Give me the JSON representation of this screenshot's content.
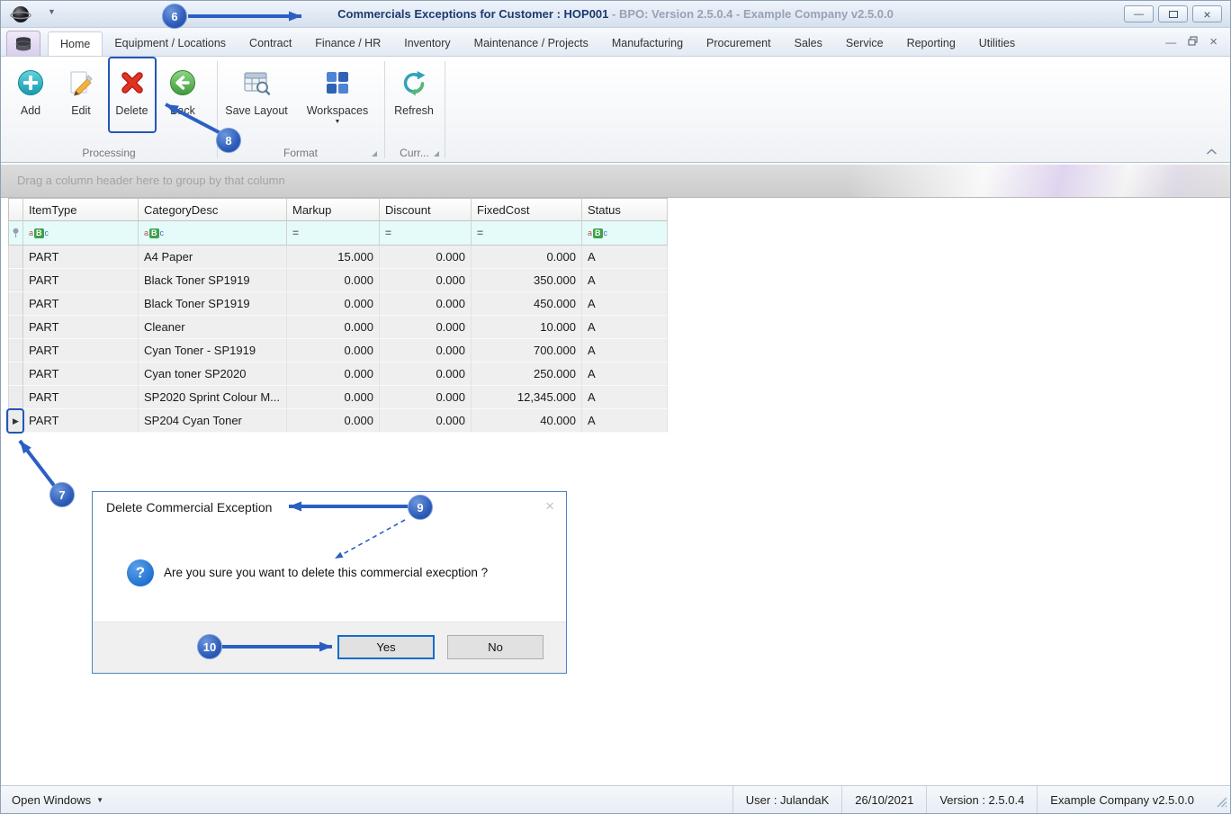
{
  "icons": {
    "app_logo": "dark-sphere",
    "dropdown": "▼",
    "minimize": "—",
    "maximize": "css-box",
    "restore": "css-double-box",
    "close": "×",
    "row_arrow": "▶",
    "filter_abc_a": "a",
    "filter_abc_b": "B",
    "filter_abc_c": "c",
    "filter_equals": "=",
    "question_mark": "?",
    "pin": "css-pin"
  },
  "titlebar": {
    "title_main": "Commercials Exceptions for Customer : HOP001",
    "title_rest": " - BPO: Version 2.5.0.4 - Example Company v2.5.0.0"
  },
  "tabs": {
    "active": "Home",
    "items": [
      "Home",
      "Equipment / Locations",
      "Contract",
      "Finance / HR",
      "Inventory",
      "Maintenance / Projects",
      "Manufacturing",
      "Procurement",
      "Sales",
      "Service",
      "Reporting",
      "Utilities"
    ]
  },
  "ribbon": {
    "buttons": {
      "add": "Add",
      "edit": "Edit",
      "delete": "Delete",
      "back": "Back",
      "save_layout": "Save Layout",
      "workspaces": "Workspaces",
      "refresh": "Refresh"
    },
    "groups": {
      "processing": "Processing",
      "format": "Format",
      "currencies": "Curr..."
    }
  },
  "grid": {
    "group_hint": "Drag a column header here to group by that column",
    "columns": [
      "ItemType",
      "CategoryDesc",
      "Markup",
      "Discount",
      "FixedCost",
      "Status"
    ],
    "rows": [
      {
        "item_type": "PART",
        "category": "A4 Paper",
        "markup": "15.000",
        "discount": "0.000",
        "fixed_cost": "0.000",
        "status": "A"
      },
      {
        "item_type": "PART",
        "category": "Black Toner SP1919",
        "markup": "0.000",
        "discount": "0.000",
        "fixed_cost": "350.000",
        "status": "A"
      },
      {
        "item_type": "PART",
        "category": "Black Toner SP1919",
        "markup": "0.000",
        "discount": "0.000",
        "fixed_cost": "450.000",
        "status": "A"
      },
      {
        "item_type": "PART",
        "category": "Cleaner",
        "markup": "0.000",
        "discount": "0.000",
        "fixed_cost": "10.000",
        "status": "A"
      },
      {
        "item_type": "PART",
        "category": "Cyan Toner - SP1919",
        "markup": "0.000",
        "discount": "0.000",
        "fixed_cost": "700.000",
        "status": "A"
      },
      {
        "item_type": "PART",
        "category": "Cyan toner SP2020",
        "markup": "0.000",
        "discount": "0.000",
        "fixed_cost": "250.000",
        "status": "A"
      },
      {
        "item_type": "PART",
        "category": "SP2020 Sprint Colour M...",
        "markup": "0.000",
        "discount": "0.000",
        "fixed_cost": "12,345.000",
        "status": "A"
      },
      {
        "item_type": "PART",
        "category": "SP204 Cyan Toner",
        "markup": "0.000",
        "discount": "0.000",
        "fixed_cost": "40.000",
        "status": "A"
      }
    ]
  },
  "dialog": {
    "title": "Delete Commercial Exception",
    "message": "Are you sure you want to delete this commercial execption ?",
    "yes_label": "Yes",
    "no_label": "No"
  },
  "statusbar": {
    "open_windows": "Open Windows",
    "user": "User : JulandaK",
    "date": "26/10/2021",
    "version": "Version : 2.5.0.4",
    "company": "Example Company v2.5.0.0"
  },
  "annotations": {
    "labels": [
      "6",
      "7",
      "8",
      "9",
      "10"
    ]
  },
  "colors": {
    "annotation_blue": "#2b5fc3",
    "delete_red": "#d8271a",
    "add_teal": "#1fa9ba",
    "back_green": "#56b14e",
    "workspace_blue": "#3a72c6",
    "filter_green": "#3da14a"
  }
}
